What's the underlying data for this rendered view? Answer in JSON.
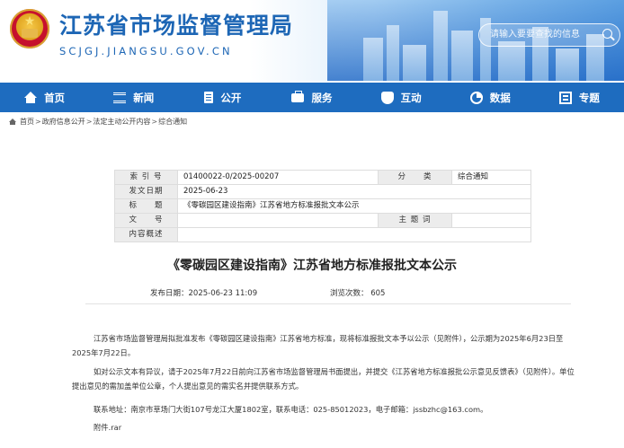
{
  "header": {
    "site_title": "江苏省市场监督管理局",
    "site_url": "SCJGJ.JIANGSU.GOV.CN",
    "search_placeholder": "请输入要要查找的信息"
  },
  "nav": {
    "items": [
      {
        "label": "首页",
        "icon": "home-icon"
      },
      {
        "label": "新闻",
        "icon": "news-icon"
      },
      {
        "label": "公开",
        "icon": "document-icon"
      },
      {
        "label": "服务",
        "icon": "briefcase-icon"
      },
      {
        "label": "互动",
        "icon": "handshake-icon"
      },
      {
        "label": "数据",
        "icon": "pie-chart-icon"
      },
      {
        "label": "专题",
        "icon": "topic-icon"
      }
    ]
  },
  "breadcrumb": {
    "items": [
      "首页",
      "政府信息公开",
      "法定主动公开内容",
      "综合通知"
    ],
    "separator": ">"
  },
  "info": {
    "index_label": "索 引 号",
    "index_value": "01400022-0/2025-00207",
    "category_label": "分　　类",
    "category_value": "综合通知",
    "date_label": "发文日期",
    "date_value": "2025-06-23",
    "title_label": "标　　题",
    "title_value": "《零碳园区建设指南》江苏省地方标准报批文本公示",
    "doc_no_label": "文　　号",
    "doc_no_value": "",
    "subject_label": "主 题 词",
    "subject_value": "",
    "summary_label": "内容概述",
    "summary_value": ""
  },
  "article": {
    "title": "《零碳园区建设指南》江苏省地方标准报批文本公示",
    "publish_time": "发布日期：2025-06-23 11:09",
    "views": "浏览次数：  605",
    "para1": "江苏省市场监督管理局拟批准发布《零碳园区建设指南》江苏省地方标准，现将标准报批文本予以公示（见附件），公示期为2025年6月23日至2025年7月22日。",
    "para2": "如对公示文本有异议，请于2025年7月22日前向江苏省市场监督管理局书面提出，并提交《江苏省地方标准报批公示意见反馈表》（见附件）。单位提出意见的需加盖单位公章，个人提出意见的需实名并提供联系方式。",
    "contact": "联系地址：南京市草场门大街107号龙江大厦1802室，联系电话：025-85012023，电子邮箱：jssbzhc@163.com。",
    "attachment": "附件.rar"
  }
}
